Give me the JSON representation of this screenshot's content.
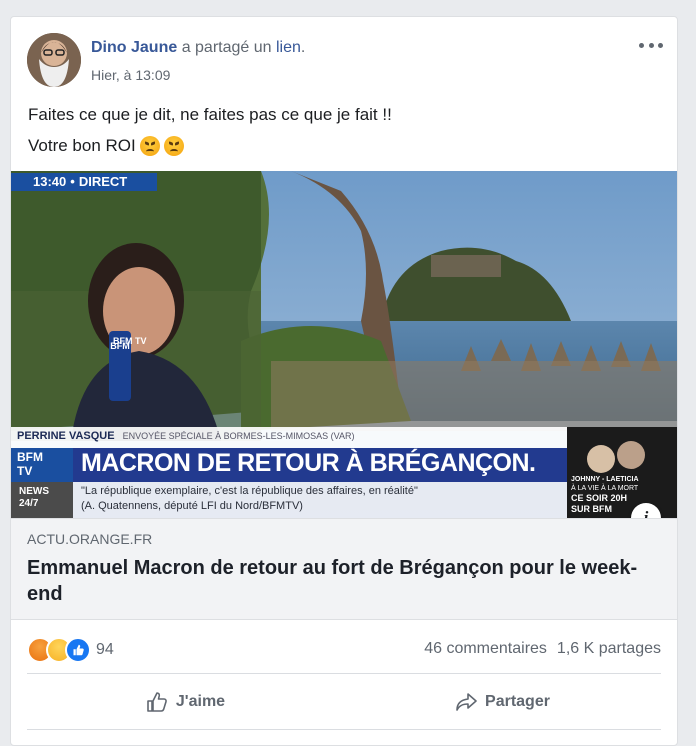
{
  "post": {
    "author": "Dino Jaune",
    "verb": "a partagé un",
    "link_word": "lien",
    "punct": ".",
    "timestamp": "Hier, à 13:09",
    "text_line1": "Faites ce que je dit, ne faites pas ce que je fait !!",
    "text_line2": "Votre bon ROI"
  },
  "link": {
    "image": {
      "time": "13:40",
      "live": "DIRECT",
      "logo": "BFM TV",
      "reporter_name": "PERRINE VASQUE",
      "reporter_role": "ENVOYÉE SPÉCIALE À BORMES-LES-MIMOSAS (VAR)",
      "banner_logo_top": "BFM",
      "banner_logo_bottom": "TV",
      "banner_title": "MACRON DE RETOUR À BRÉGANÇON.",
      "ticker_label_top": "NEWS",
      "ticker_label_bottom": "24/7",
      "quote_line1": "\"La république exemplaire, c'est la république des affaires, en réalité\"",
      "quote_line2": "(A. Quatennens, député LFI du Nord/BFMTV)",
      "promo_top": "JOHNNY - LAETICIA",
      "promo_mid": "À LA VIE À LA MORT",
      "promo_bottom": "CE SOIR 20H",
      "promo_tail": "SUR BFM"
    },
    "domain": "ACTU.ORANGE.FR",
    "headline": "Emmanuel Macron de retour au fort de Brégançon pour le week-end",
    "info": "i"
  },
  "stats": {
    "reaction_count": "94",
    "comments": "46 commentaires",
    "shares": "1,6 K partages"
  },
  "actions": {
    "like": "J'aime",
    "share": "Partager"
  },
  "reaction_icons": [
    "angry-reaction-icon",
    "haha-reaction-icon",
    "like-reaction-icon"
  ],
  "colors": {
    "author_link": "#385898",
    "muted_text": "#606770",
    "bfm_blue": "#1a4fa0",
    "banner_blue": "#223a8f"
  }
}
